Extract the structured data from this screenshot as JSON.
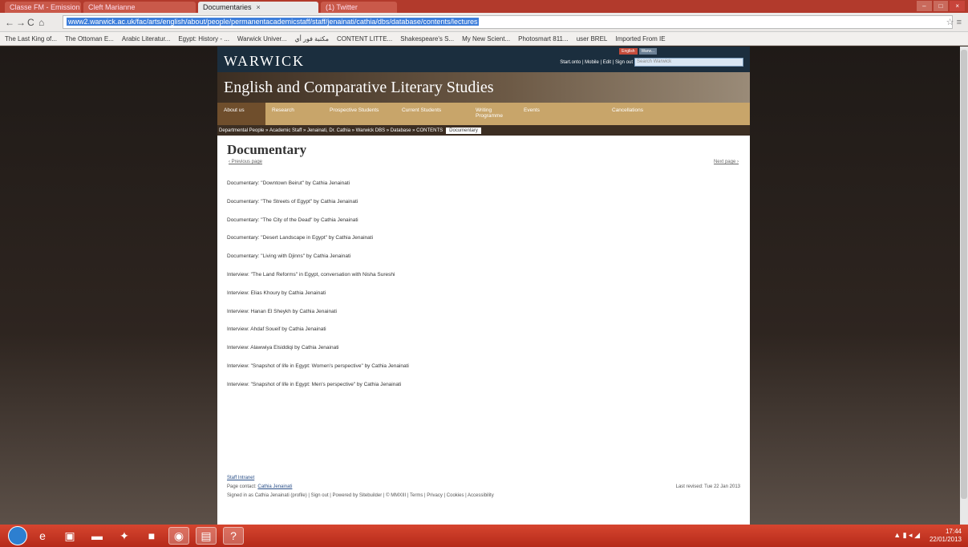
{
  "browser": {
    "tabs": [
      {
        "label": "Classe FM - Emission"
      },
      {
        "label": "Cleft Marianne"
      },
      {
        "label": "Documentaries"
      },
      {
        "label": "(1) Twitter"
      }
    ],
    "url": "www2.warwick.ac.uk/fac/arts/english/about/people/permanentacademicstaff/staff/jenainati/cathia/dbs/database/contents/lectures",
    "bookmarks": [
      "The Last King of...",
      "The Ottoman E...",
      "Arabic Literatur...",
      "Egypt: History - ...",
      "Warwick Univer...",
      "مكتبة فور أي",
      "CONTENT LITTE...",
      "Shakespeare's S...",
      "My New Scient...",
      "Photosmart 811...",
      "user BREL",
      "Imported From IE"
    ]
  },
  "site": {
    "logo": "WARWICK",
    "top_links": "Start.onto | Mobile | Edit | Sign out",
    "top_tabs": [
      "English",
      "Warw..."
    ],
    "search_placeholder": "Search Warwick",
    "department": "English and Comparative Literary Studies",
    "nav": [
      "About us",
      "Research",
      "Prospective Students",
      "Current Students",
      "Writing Programme",
      "Events",
      "Cancellations"
    ],
    "breadcrumb": [
      "Departmental People",
      "Academic Staff",
      "Jenainati, Dr. Cathia",
      "Warwick DBS",
      "Database",
      "CONTENTS"
    ],
    "breadcrumb_current": "Documentary"
  },
  "page": {
    "title": "Documentary",
    "prev": "‹ Previous page",
    "next": "Next page ›",
    "items": [
      "Documentary: \"Downtown Beirut\" by Cathia Jenainati",
      "Documentary: \"The Streets of Egypt\" by Cathia Jenainati",
      "Documentary: \"The City of the Dead\" by Cathia Jenainati",
      "Documentary: \"Desert Landscape in Egypt\" by Cathia Jenainati",
      "Documentary: \"Living with Djinns\" by Cathia Jenainati",
      "Interview: \"The Land Reforms\" in Egypt, conversation with Nisha Sureshi",
      "Interview: Elias Khoury by Cathia Jenainati",
      "Interview: Hanan El Sheykh by Cathia Jenainati",
      "Interview: Ahdaf Soueif by Cathia Jenainati",
      "Interview: Alawwiya Elsiddiqi by Cathia Jenainati",
      "Interview: \"Snapshot of life in Egypt: Women's perspective\" by Cathia Jenainati",
      "Interview: \"Snapshot of life in Egypt: Men's perspective\" by Cathia Jenainati"
    ]
  },
  "footer": {
    "staff_intranet": "Staff Intranet",
    "page_contact_label": "Page contact:",
    "page_contact_name": "Cathia Jenainati",
    "last_revised": "Last revised: Tue 22 Jan 2013",
    "signed_in": "Signed in as Cathia Jenainati (profile) | Sign out | Powered by Sitebuilder | © MMXIII | Terms | Privacy | Cookies | Accessibility"
  },
  "taskbar": {
    "time": "17:44",
    "date": "22/01/2013"
  }
}
